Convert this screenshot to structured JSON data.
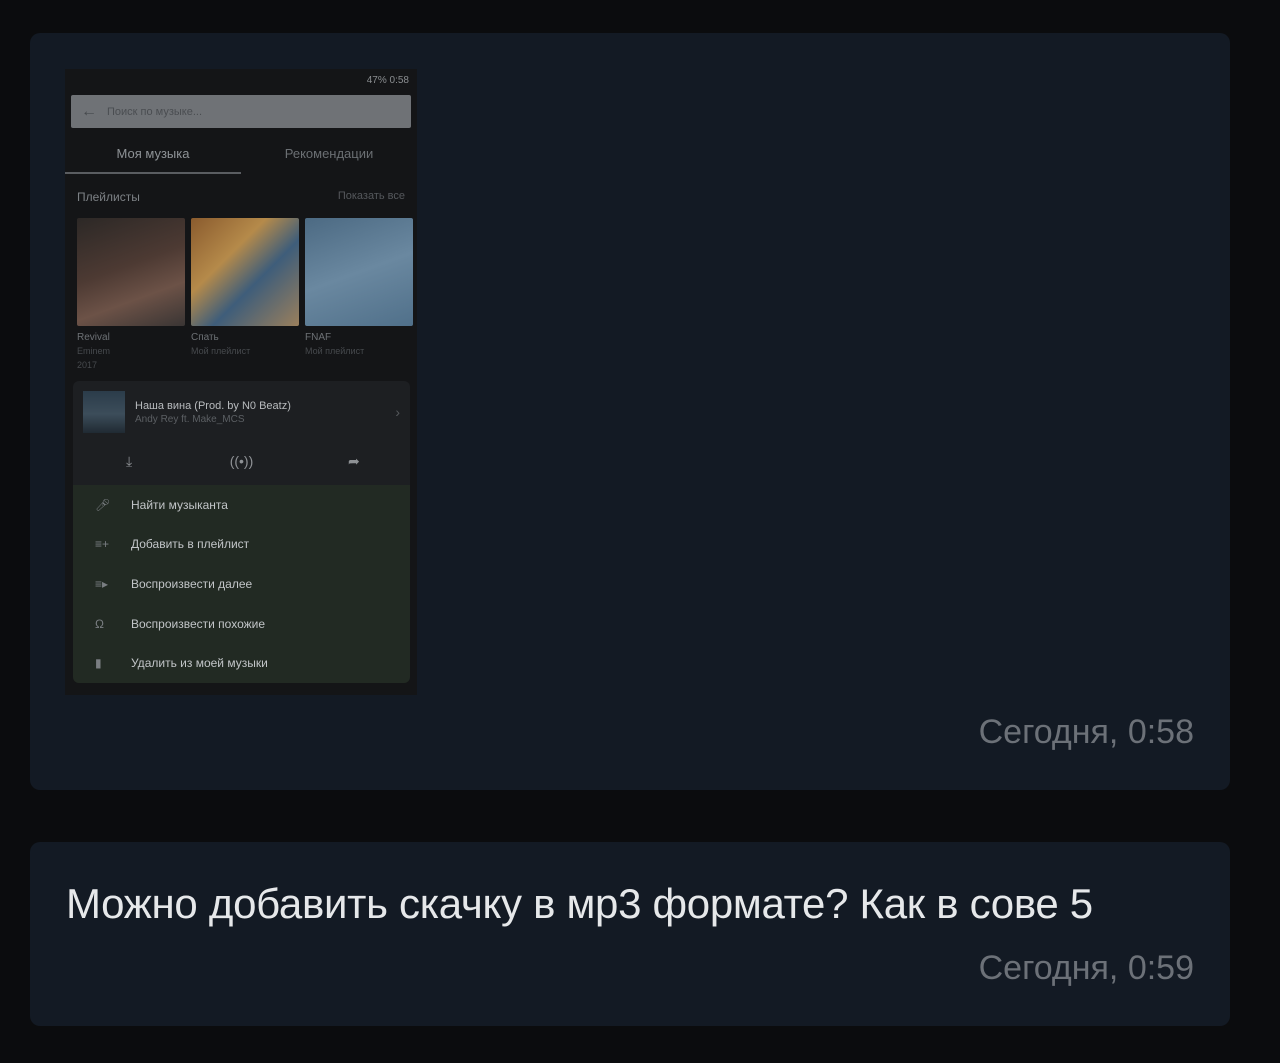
{
  "messages": [
    {
      "time": "Сегодня, 0:58",
      "attachment": {
        "status_bar": "47% 0:58",
        "search_placeholder": "Поиск по музыке...",
        "tabs": [
          "Моя музыка",
          "Рекомендации"
        ],
        "playlists_header": "Плейлисты",
        "show_all": "Показать все",
        "playlists": [
          {
            "title": "Revival",
            "sub1": "Eminem",
            "sub2": "2017"
          },
          {
            "title": "Спать",
            "sub1": "Мой плейлист",
            "sub2": ""
          },
          {
            "title": "FNAF",
            "sub1": "Мой плейлист",
            "sub2": ""
          }
        ],
        "track": {
          "title": "Наша вина (Prod. by N0 Beatz)",
          "artist": "Andy Rey ft. Make_MCS"
        },
        "track_actions": {
          "download_icon": "download-icon",
          "broadcast_icon": "broadcast-icon",
          "share_icon": "share-icon"
        },
        "menu": [
          {
            "icon": "mic-icon",
            "label": "Найти музыканта"
          },
          {
            "icon": "playlist-add-icon",
            "label": "Добавить в плейлист"
          },
          {
            "icon": "play-next-icon",
            "label": "Воспроизвести далее"
          },
          {
            "icon": "headphones-icon",
            "label": "Воспроизвести похожие"
          },
          {
            "icon": "trash-icon",
            "label": "Удалить из моей музыки"
          }
        ]
      }
    },
    {
      "text": "Можно добавить скачку в мр3 формате? Как в сове 5",
      "time": "Сегодня, 0:59"
    }
  ]
}
